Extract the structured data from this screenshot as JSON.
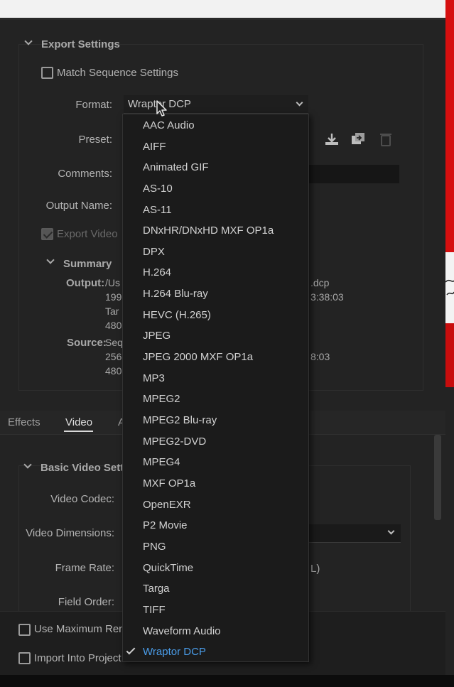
{
  "export_settings": {
    "title": "Export Settings",
    "match_sequence": "Match Sequence Settings",
    "format_label": "Format:",
    "format_value": "Wraptor DCP",
    "preset_label": "Preset:",
    "comments_label": "Comments:",
    "output_name_label": "Output Name:",
    "export_video": "Export Video"
  },
  "summary": {
    "title": "Summary",
    "output_label": "Output:",
    "output_lines": [
      "/Us",
      "199",
      "Tar",
      "480"
    ],
    "output_tail": [
      ".dcp",
      "3:38:03"
    ],
    "source_label": "Source:",
    "source_lines": [
      "Seq",
      "256",
      "480"
    ],
    "source_tail": [
      "8:03"
    ]
  },
  "tabs": [
    "Effects",
    "Video",
    "A"
  ],
  "basic_video": {
    "title": "Basic Video Setti",
    "video_codec_label": "Video Codec:",
    "video_dimensions_label": "Video Dimensions:",
    "frame_rate_label": "Frame Rate:",
    "frame_rate_tail": "L)",
    "field_order_label": "Field Order:"
  },
  "bottom": {
    "use_max_render": "Use Maximum Ren",
    "import_into_project": "Import Into Project"
  },
  "format_options": [
    "AAC Audio",
    "AIFF",
    "Animated GIF",
    "AS-10",
    "AS-11",
    "DNxHR/DNxHD MXF OP1a",
    "DPX",
    "H.264",
    "H.264 Blu-ray",
    "HEVC (H.265)",
    "JPEG",
    "JPEG 2000 MXF OP1a",
    "MP3",
    "MPEG2",
    "MPEG2 Blu-ray",
    "MPEG2-DVD",
    "MPEG4",
    "MXF OP1a",
    "OpenEXR",
    "P2 Movie",
    "PNG",
    "QuickTime",
    "Targa",
    "TIFF",
    "Waveform Audio",
    "Wraptor DCP"
  ],
  "selected_format": "Wraptor DCP",
  "colors": {
    "selected": "#4a9ce8",
    "panel": "#232323"
  }
}
